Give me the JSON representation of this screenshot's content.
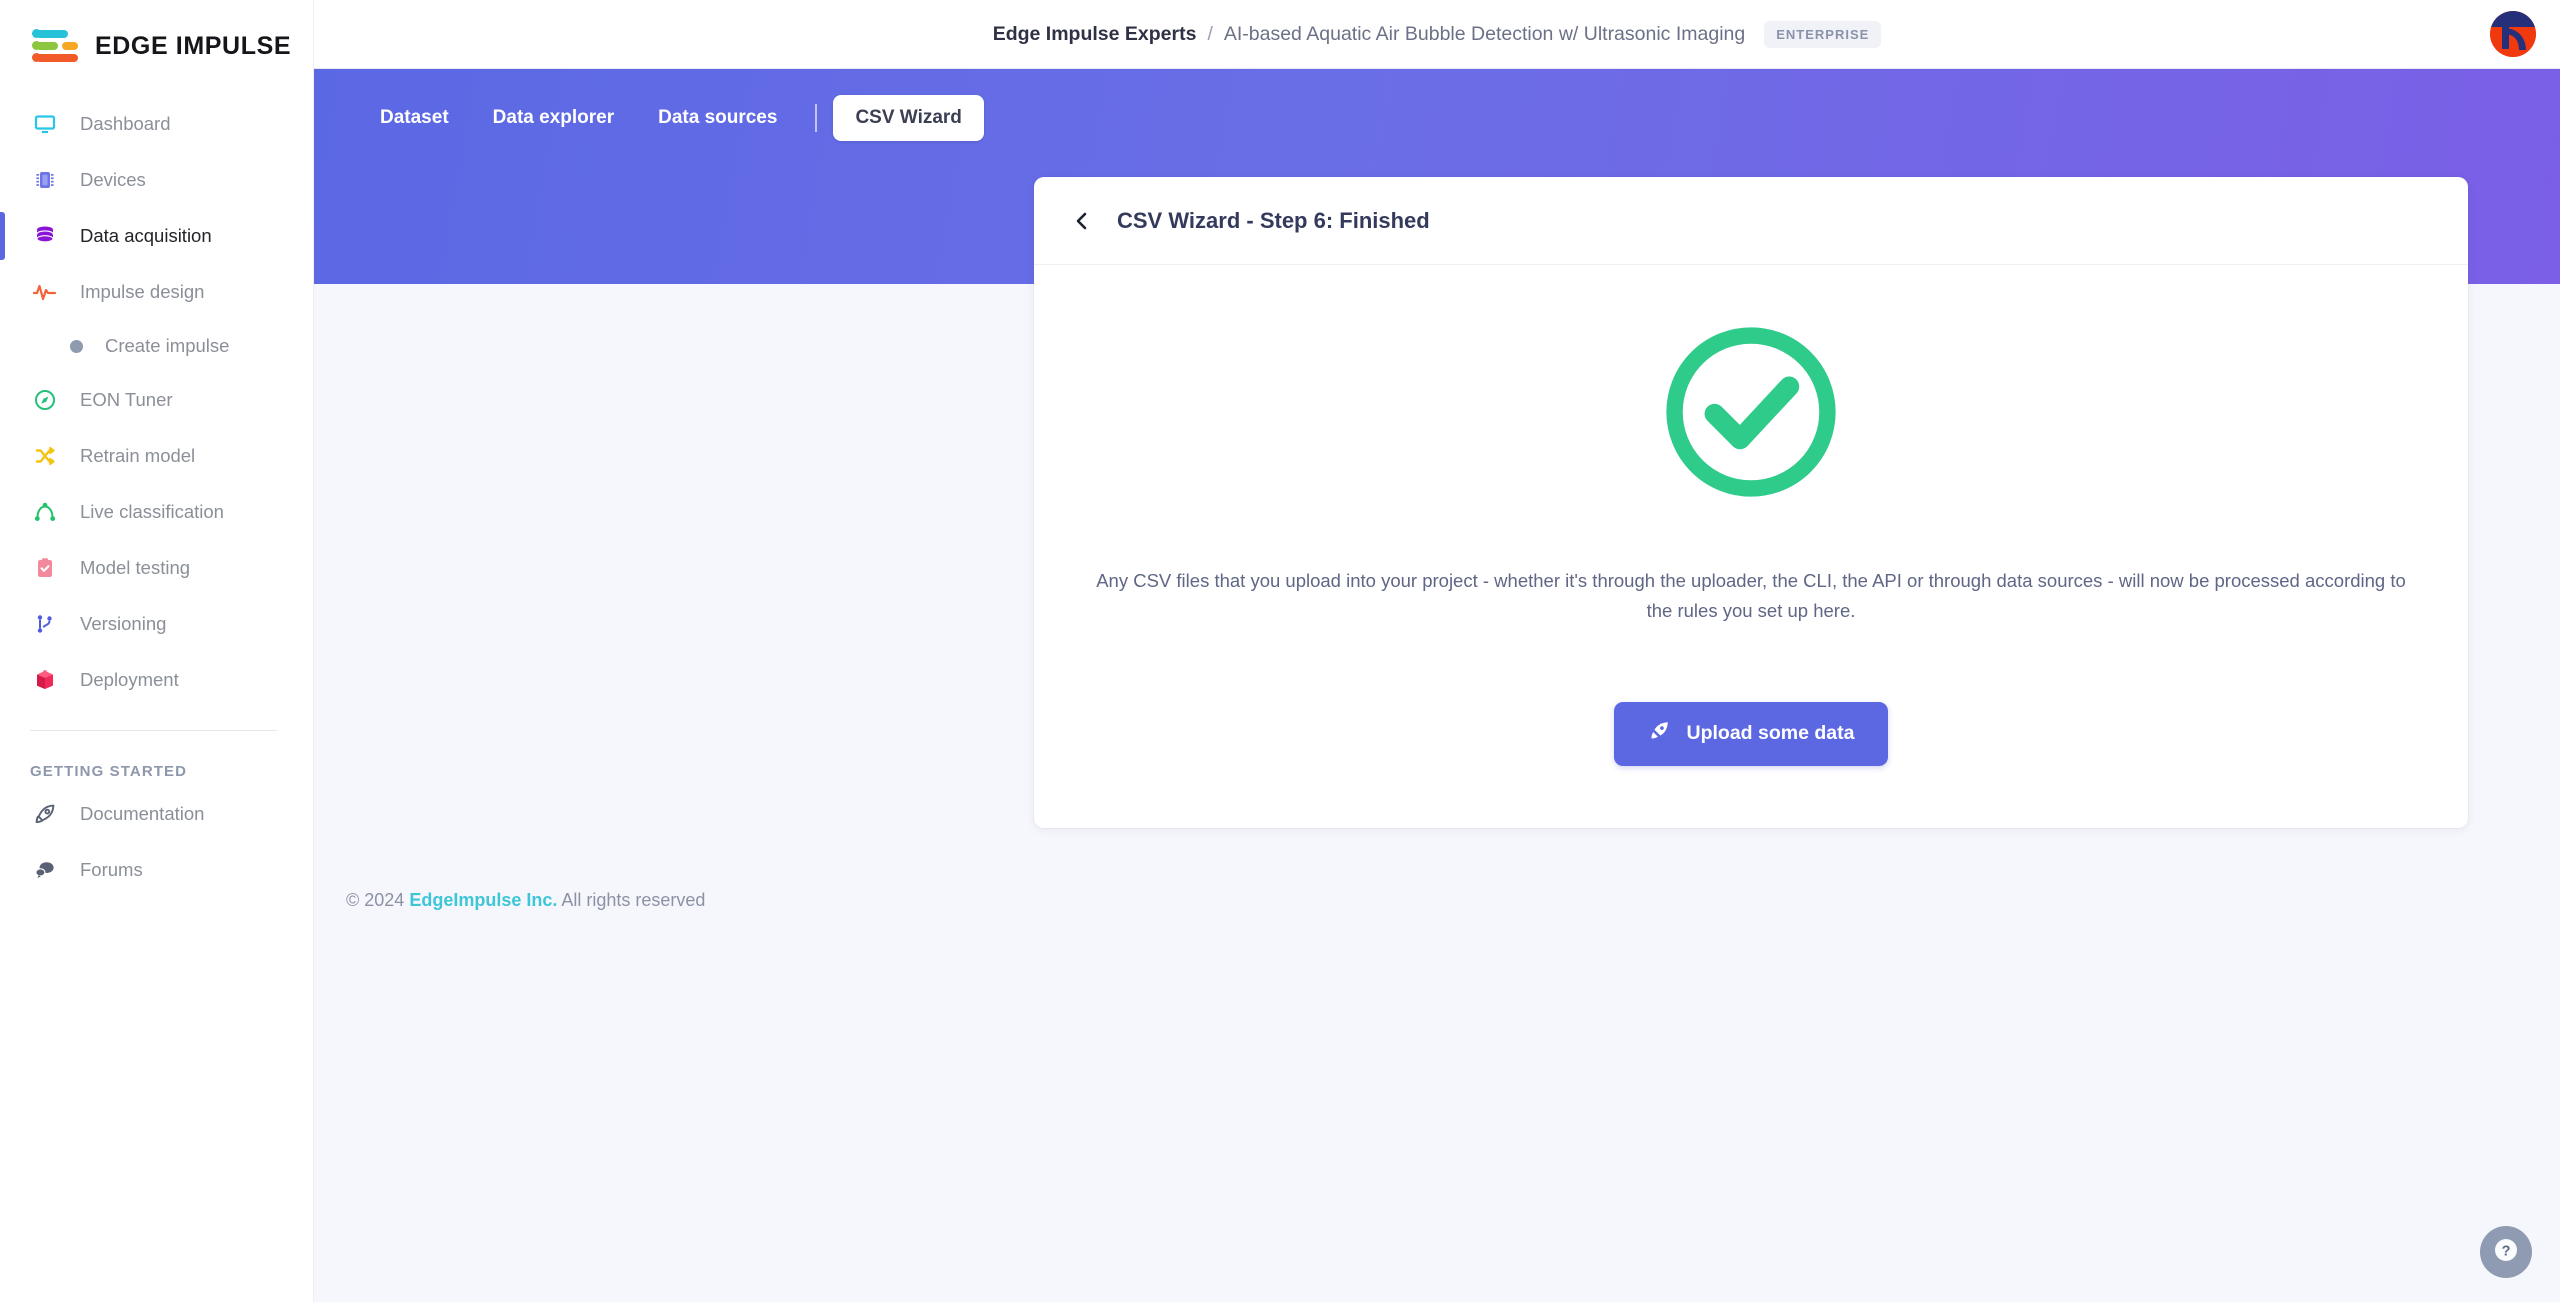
{
  "brand": {
    "name": "EDGE IMPULSE",
    "logo_colors": [
      "#25c2d8",
      "#8cc63f",
      "#f7a823",
      "#f15a29"
    ]
  },
  "sidebar": {
    "items": [
      {
        "label": "Dashboard",
        "icon": "monitor-icon",
        "color": "#29c5e8",
        "active": false
      },
      {
        "label": "Devices",
        "icon": "chip-icon",
        "color": "#6b74e8",
        "active": false
      },
      {
        "label": "Data acquisition",
        "icon": "database-icon",
        "color": "#8a14d6",
        "active": true
      },
      {
        "label": "Impulse design",
        "icon": "pulse-icon",
        "color": "#f4623a",
        "active": false
      },
      {
        "label": "EON Tuner",
        "icon": "compass-icon",
        "color": "#27c07a",
        "active": false
      },
      {
        "label": "Retrain model",
        "icon": "shuffle-icon",
        "color": "#f4c413",
        "active": false
      },
      {
        "label": "Live classification",
        "icon": "network-icon",
        "color": "#22c26b",
        "active": false
      },
      {
        "label": "Model testing",
        "icon": "clipboard-check-icon",
        "color": "#f3899c",
        "active": false
      },
      {
        "label": "Versioning",
        "icon": "git-branch-icon",
        "color": "#4f5ce0",
        "active": false
      },
      {
        "label": "Deployment",
        "icon": "box-icon",
        "color": "#f0295b",
        "active": false
      }
    ],
    "sub_item": {
      "label": "Create impulse",
      "icon": "dot-icon"
    },
    "section_title": "GETTING STARTED",
    "getting_started": [
      {
        "label": "Documentation",
        "icon": "rocket-icon",
        "color": "#5a6175"
      },
      {
        "label": "Forums",
        "icon": "chat-icon",
        "color": "#5a6175"
      }
    ]
  },
  "header": {
    "org": "Edge Impulse Experts",
    "separator": "/",
    "project": "AI-based Aquatic Air Bubble Detection w/ Ultrasonic Imaging",
    "plan_badge": "ENTERPRISE",
    "avatar": "user-avatar"
  },
  "tabs": [
    {
      "label": "Dataset",
      "active": false
    },
    {
      "label": "Data explorer",
      "active": false
    },
    {
      "label": "Data sources",
      "active": false
    },
    {
      "label": "CSV Wizard",
      "active": true
    }
  ],
  "card": {
    "back": "back-chevron",
    "title": "CSV Wizard - Step 6: Finished",
    "status_icon": "success-check-icon",
    "status_color": "#2fcb8a",
    "description": "Any CSV files that you upload into your project - whether it's through the uploader, the CLI, the API or through data sources - will now be processed according to the rules you set up here.",
    "upload_button": "Upload some data",
    "upload_icon": "rocket-icon",
    "upload_color": "#5c68e2"
  },
  "footer": {
    "copyright": "© 2024",
    "company": "EdgeImpulse Inc.",
    "rights": "All rights reserved"
  },
  "help": {
    "icon": "question-mark-icon",
    "label": "?"
  },
  "theme": {
    "banner_start": "#5b68e4",
    "banner_end": "#7b5fe6",
    "page_bg": "#f6f7fc"
  }
}
